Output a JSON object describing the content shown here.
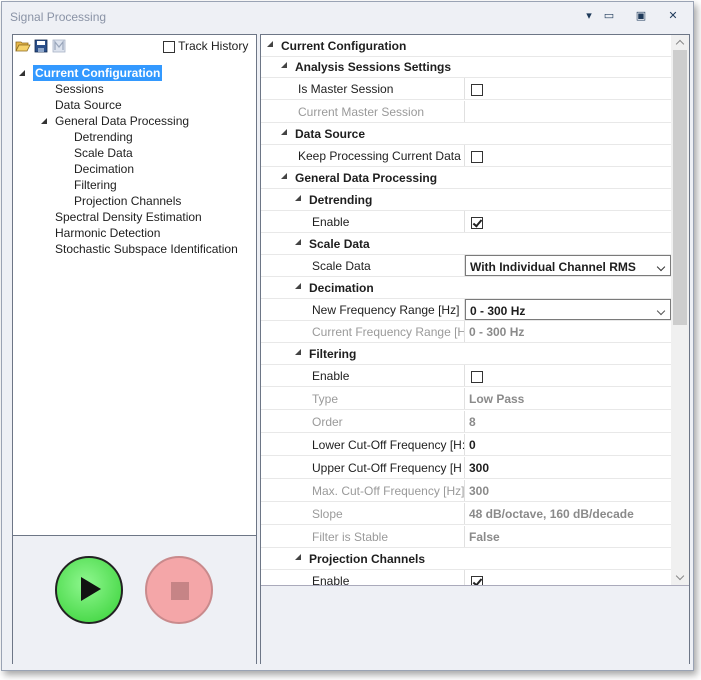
{
  "window": {
    "title": "Signal Processing"
  },
  "left": {
    "track_history_label": "Track History",
    "tree": [
      {
        "label": "Current Configuration",
        "level": 0,
        "expanded": true,
        "selected": true
      },
      {
        "label": "Sessions",
        "level": 1
      },
      {
        "label": "Data Source",
        "level": 1
      },
      {
        "label": "General Data Processing",
        "level": 1,
        "expanded": true
      },
      {
        "label": "Detrending",
        "level": 2
      },
      {
        "label": "Scale Data",
        "level": 2
      },
      {
        "label": "Decimation",
        "level": 2
      },
      {
        "label": "Filtering",
        "level": 2
      },
      {
        "label": "Projection Channels",
        "level": 2
      },
      {
        "label": "Spectral Density Estimation",
        "level": 1
      },
      {
        "label": "Harmonic Detection",
        "level": 1
      },
      {
        "label": "Stochastic Subspace Identification",
        "level": 1
      }
    ]
  },
  "grid": {
    "root": "Current Configuration",
    "analysis_sessions": {
      "title": "Analysis Sessions Settings",
      "is_master_label": "Is Master Session",
      "current_master_label": "Current Master Session",
      "current_master_value": ""
    },
    "data_source": {
      "title": "Data Source",
      "keep_processing_label": "Keep Processing Current Data"
    },
    "general": {
      "title": "General Data Processing",
      "detrending": {
        "title": "Detrending",
        "enable_label": "Enable"
      },
      "scale_data": {
        "title": "Scale Data",
        "label": "Scale Data",
        "value": "With Individual Channel RMS"
      },
      "decimation": {
        "title": "Decimation",
        "new_label": "New Frequency Range [Hz]",
        "new_value": "0 - 300 Hz",
        "current_label": "Current Frequency Range [H",
        "current_value": "0 - 300 Hz"
      },
      "filtering": {
        "title": "Filtering",
        "enable_label": "Enable",
        "type_label": "Type",
        "type_value": "Low Pass",
        "order_label": "Order",
        "order_value": "8",
        "lower_label": "Lower Cut-Off Frequency [H:",
        "lower_value": "0",
        "upper_label": "Upper Cut-Off Frequency [H",
        "upper_value": "300",
        "max_label": "Max. Cut-Off Frequency [Hz]",
        "max_value": "300",
        "slope_label": "Slope",
        "slope_value": "48 dB/octave, 160 dB/decade",
        "stable_label": "Filter is Stable",
        "stable_value": "False"
      },
      "projection": {
        "title": "Projection Channels",
        "enable_label": "Enable"
      }
    }
  },
  "colors": {
    "selection": "#3399ff",
    "play": "#35d035",
    "stop": "#f4a6a8"
  }
}
